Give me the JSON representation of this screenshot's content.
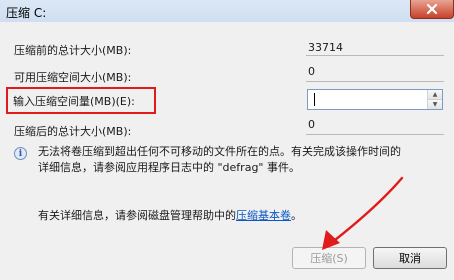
{
  "window": {
    "title": "压缩 C:"
  },
  "rows": [
    {
      "label": "压缩前的总计大小(MB):",
      "value": "33714"
    },
    {
      "label": "可用压缩空间大小(MB):",
      "value": "0"
    },
    {
      "label": "输入压缩空间量(MB)(E):",
      "value": ""
    },
    {
      "label": "压缩后的总计大小(MB):",
      "value": "0"
    }
  ],
  "info": {
    "line1": "无法将卷压缩到超出任何不可移动的文件所在的点。有关完成该操作时间的",
    "line2": "详细信息，请参阅应用程序日志中的 \"defrag\" 事件。"
  },
  "help": {
    "prefix": "有关详细信息，请参阅磁盘管理帮助中的",
    "link": "压缩基本卷",
    "suffix": "。"
  },
  "buttons": {
    "ok": "压缩(S)",
    "cancel": "取消"
  },
  "colors": {
    "annotation": "#e11b1b"
  }
}
